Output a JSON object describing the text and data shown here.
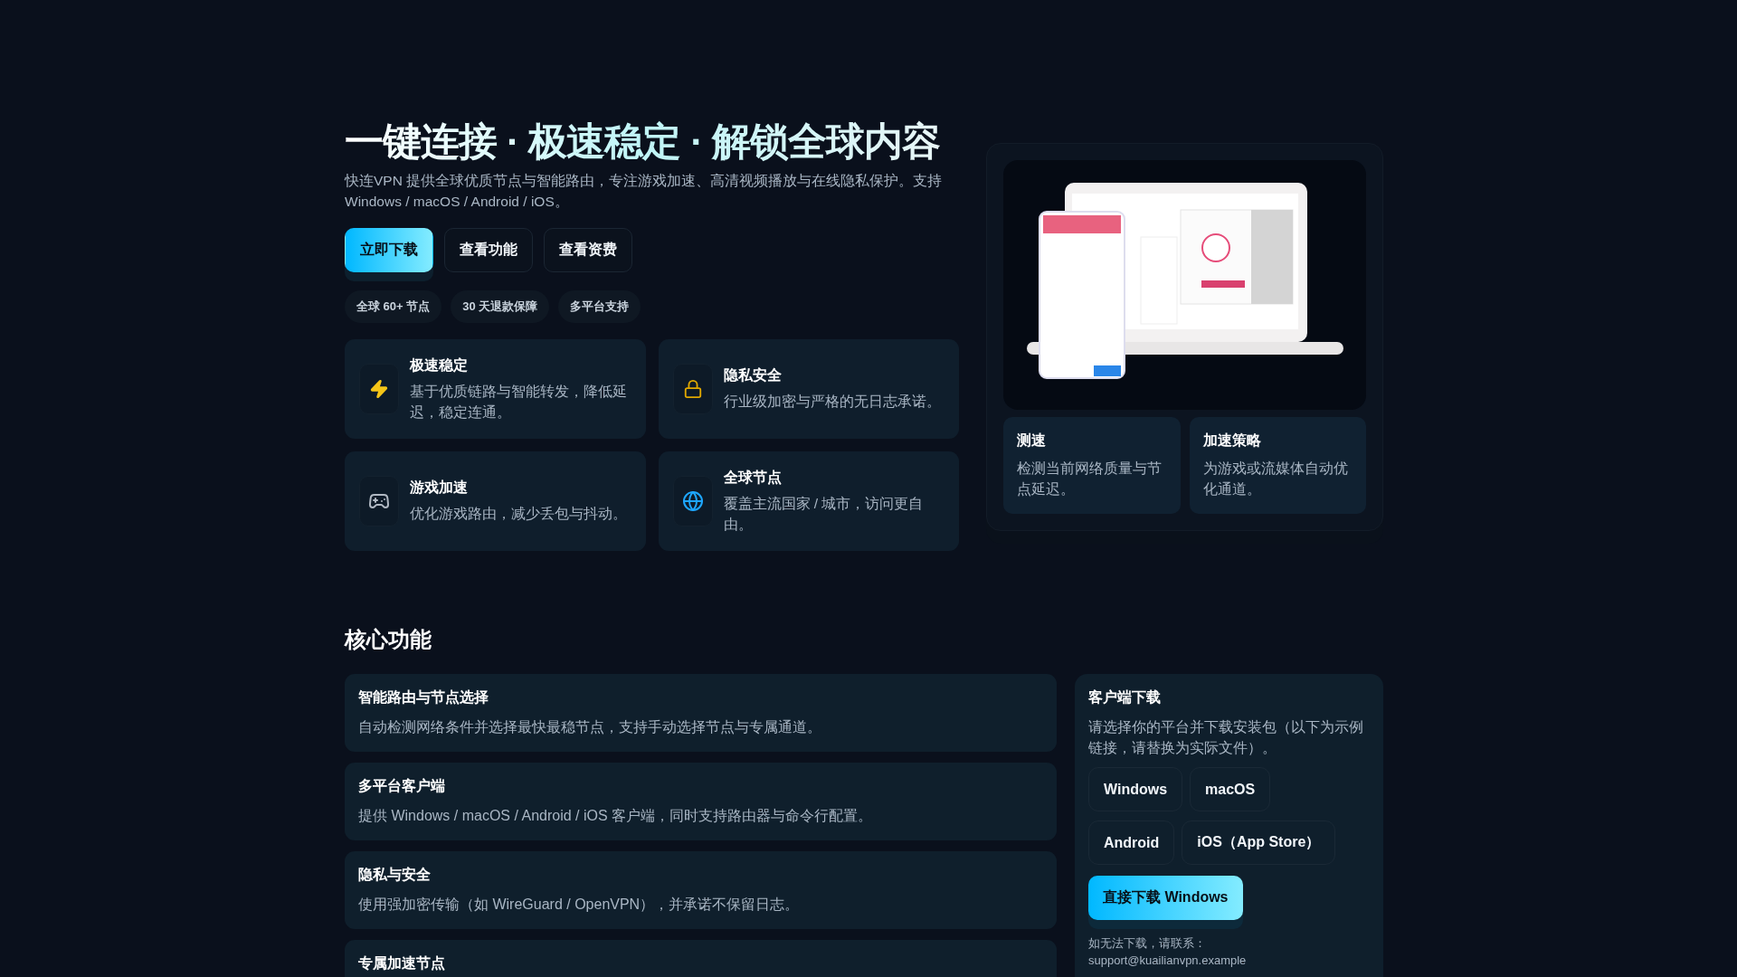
{
  "hero": {
    "title": "一键连接 · 极速稳定 · 解锁全球内容",
    "subtitle": "快连VPN 提供全球优质节点与智能路由，专注游戏加速、高清视频播放与在线隐私保护。支持 Windows / macOS / Android / iOS。",
    "buttons": [
      {
        "label": "立即下载",
        "kind": "primary"
      },
      {
        "label": "查看功能",
        "kind": "secondary"
      },
      {
        "label": "查看资费",
        "kind": "secondary"
      }
    ],
    "badges": [
      "全球 60+ 节点",
      "30 天退款保障",
      "多平台支持"
    ],
    "cards": [
      {
        "title": "极速稳定",
        "text": "基于优质链路与智能转发，降低延迟，稳定连通。"
      },
      {
        "title": "隐私安全",
        "text": "行业级加密与严格的无日志承诺。"
      },
      {
        "title": "游戏加速",
        "text": "优化游戏路由，减少丢包与抖动。"
      },
      {
        "title": "全球节点",
        "text": "覆盖主流国家 / 城市，访问更自由。"
      }
    ]
  },
  "preview": {
    "tiles": [
      {
        "title": "测速",
        "text": "检测当前网络质量与节点延迟。"
      },
      {
        "title": "加速策略",
        "text": "为游戏或流媒体自动优化通道。"
      }
    ]
  },
  "core": {
    "heading": "核心功能",
    "items": [
      {
        "title": "智能路由与节点选择",
        "text": "自动检测网络条件并选择最快最稳节点，支持手动选择节点与专属通道。"
      },
      {
        "title": "多平台客户端",
        "text": "提供 Windows / macOS / Android / iOS 客户端，同时支持路由器与命令行配置。"
      },
      {
        "title": "隐私与安全",
        "text": "使用强加密传输（如 WireGuard / OpenVPN），并承诺不保留日志。"
      },
      {
        "title": "专属加速节点"
      }
    ]
  },
  "download": {
    "title": "客户端下载",
    "text": "请选择你的平台并下载安装包（以下为示例链接，请替换为实际文件）。",
    "platforms": [
      [
        "Windows",
        "macOS"
      ],
      [
        "Android",
        "iOS（App Store）"
      ]
    ],
    "primary": "直接下载 Windows",
    "contact_label": "如无法下载，请联系：",
    "contact_email": "support@kuailianvpn.example"
  }
}
